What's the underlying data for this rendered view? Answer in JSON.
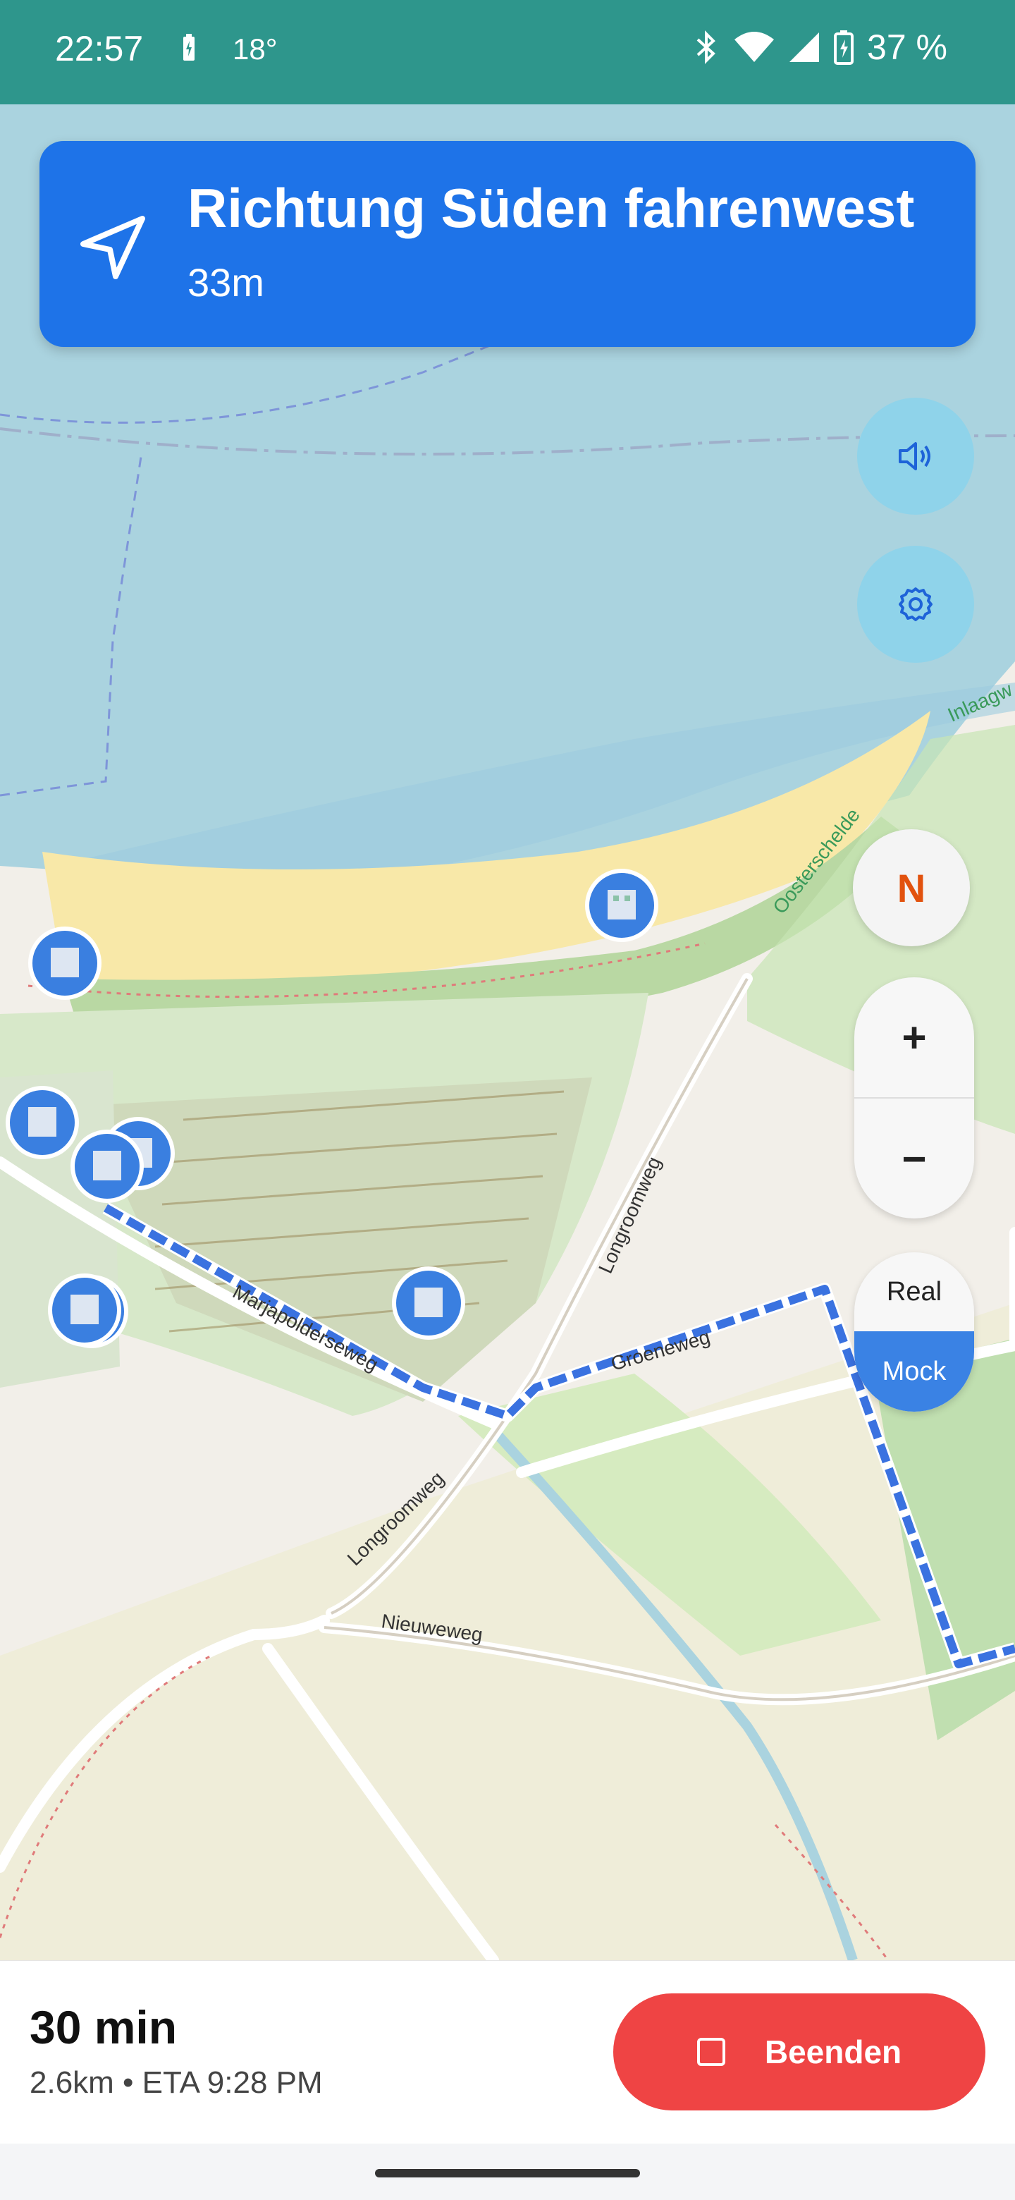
{
  "status_bar": {
    "time": "22:57",
    "temperature": "18°",
    "battery": "37 %"
  },
  "navigation": {
    "instruction": "Richtung Süden fahrenwest",
    "distance": "33m"
  },
  "map_controls": {
    "compass_label": "N",
    "zoom_in_label": "+",
    "zoom_out_label": "−",
    "mode_real": "Real",
    "mode_mock": "Mock",
    "selected_mode": "Mock"
  },
  "map_labels": {
    "road1": "Marjapolderseweg",
    "road2": "Longroomweg",
    "road3": "Longroomweg",
    "road4": "Nieuweweg",
    "road5": "Oosterschelde",
    "road6": "Inlaagw",
    "road7": "Groeneweg"
  },
  "trip": {
    "remaining_time": "30 min",
    "details": "2.6km • ETA 9:28 PM"
  },
  "end_button_label": "Beenden",
  "colors": {
    "status_bar": "#2e968c",
    "banner": "#1e73e8",
    "end_button": "#ef4444",
    "route": "#3a72e0"
  }
}
